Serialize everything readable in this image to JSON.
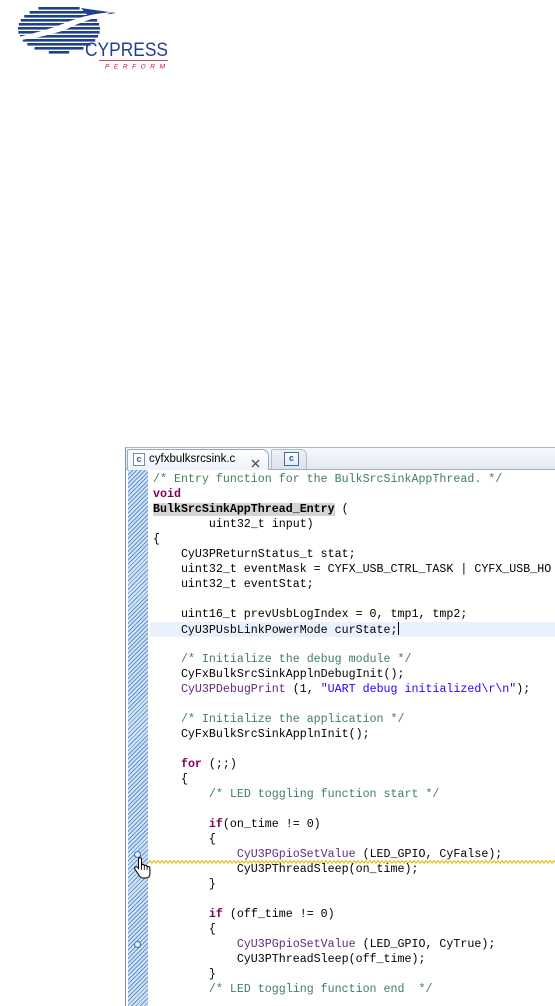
{
  "logo": {
    "icon": "cypress-globe-logo",
    "wordmark": "CYPRESS",
    "tagline": "PERFORM",
    "navy": "#1f3e95",
    "red": "#c8102e"
  },
  "editor": {
    "tabs": [
      {
        "label": "cyfxbulksrcsink.c",
        "icon": "c-source-file-icon",
        "icon_glyph": "c",
        "close_icon": "close-icon",
        "active": true
      },
      {
        "icon": "c-source-file-icon",
        "icon_glyph": "c",
        "active": false
      }
    ],
    "theme": {
      "plain": "#000000",
      "comment": "#3F7F5F",
      "keyword": "#7F0055",
      "string": "#2A00FF",
      "macro": "#642880",
      "current_line": "#E8F2FE",
      "occurrence": "#D4D4D4",
      "warning": "#E2B600",
      "ruler": "#5E93D1"
    },
    "cursor_icon": "hand-pointer-cursor-icon",
    "lines": [
      {
        "tokens": [
          {
            "k": "comment",
            "v": "/* Entry function for the BulkSrcSinkAppThread. */"
          }
        ]
      },
      {
        "tokens": [
          {
            "k": "keyword",
            "v": "void"
          }
        ]
      },
      {
        "tokens": [
          {
            "k": "decl",
            "v": "BulkSrcSinkAppThread_Entry",
            "highlight": true
          },
          {
            "k": "plain",
            "v": " ("
          }
        ]
      },
      {
        "tokens": [
          {
            "k": "plain",
            "v": "        uint32_t input)"
          }
        ]
      },
      {
        "tokens": [
          {
            "k": "plain",
            "v": "{"
          }
        ]
      },
      {
        "tokens": [
          {
            "k": "plain",
            "v": "    CyU3PReturnStatus_t stat;"
          }
        ]
      },
      {
        "tokens": [
          {
            "k": "plain",
            "v": "    uint32_t eventMask = CYFX_USB_CTRL_TASK | CYFX_USB_HO"
          }
        ]
      },
      {
        "tokens": [
          {
            "k": "plain",
            "v": "    uint32_t eventStat;"
          }
        ]
      },
      {
        "tokens": []
      },
      {
        "tokens": [
          {
            "k": "plain",
            "v": "    uint16_t prevUsbLogIndex = 0, tmp1, tmp2;"
          }
        ]
      },
      {
        "tokens": [
          {
            "k": "plain",
            "v": "    CyU3PUsbLinkPowerMode curState;"
          }
        ],
        "current": true
      },
      {
        "tokens": []
      },
      {
        "tokens": [
          {
            "k": "plain",
            "v": "    "
          },
          {
            "k": "comment",
            "v": "/* Initialize the debug module */"
          }
        ]
      },
      {
        "tokens": [
          {
            "k": "plain",
            "v": "    CyFxBulkSrcSinkApplnDebugInit();"
          }
        ]
      },
      {
        "tokens": [
          {
            "k": "plain",
            "v": "    "
          },
          {
            "k": "macro",
            "v": "CyU3PDebugPrint"
          },
          {
            "k": "plain",
            "v": " (1, "
          },
          {
            "k": "string",
            "v": "\"UART debug initialized\\r\\n\""
          },
          {
            "k": "plain",
            "v": ");"
          }
        ]
      },
      {
        "tokens": []
      },
      {
        "tokens": [
          {
            "k": "plain",
            "v": "    "
          },
          {
            "k": "comment",
            "v": "/* Initialize the application */"
          }
        ]
      },
      {
        "tokens": [
          {
            "k": "plain",
            "v": "    CyFxBulkSrcSinkApplnInit();"
          }
        ]
      },
      {
        "tokens": []
      },
      {
        "tokens": [
          {
            "k": "plain",
            "v": "    "
          },
          {
            "k": "keyword",
            "v": "for"
          },
          {
            "k": "plain",
            "v": " (;;)"
          }
        ]
      },
      {
        "tokens": [
          {
            "k": "plain",
            "v": "    {"
          }
        ]
      },
      {
        "tokens": [
          {
            "k": "plain",
            "v": "        "
          },
          {
            "k": "comment",
            "v": "/* LED toggling function start */"
          }
        ]
      },
      {
        "tokens": []
      },
      {
        "tokens": [
          {
            "k": "plain",
            "v": "        "
          },
          {
            "k": "keyword",
            "v": "if"
          },
          {
            "k": "plain",
            "v": "(on_time != 0)"
          }
        ]
      },
      {
        "tokens": [
          {
            "k": "plain",
            "v": "        {"
          }
        ]
      },
      {
        "tokens": [
          {
            "k": "plain",
            "v": "            "
          },
          {
            "k": "macro",
            "v": "CyU3PGpioSetValue"
          },
          {
            "k": "plain",
            "v": " (LED_GPIO, CyFalse);"
          }
        ],
        "warning": true,
        "marker": true
      },
      {
        "tokens": [
          {
            "k": "plain",
            "v": "            CyU3PThreadSleep(on_time);"
          }
        ]
      },
      {
        "tokens": [
          {
            "k": "plain",
            "v": "        }"
          }
        ]
      },
      {
        "tokens": []
      },
      {
        "tokens": [
          {
            "k": "plain",
            "v": "        "
          },
          {
            "k": "keyword",
            "v": "if"
          },
          {
            "k": "plain",
            "v": " (off_time != 0)"
          }
        ]
      },
      {
        "tokens": [
          {
            "k": "plain",
            "v": "        {"
          }
        ]
      },
      {
        "tokens": [
          {
            "k": "plain",
            "v": "            "
          },
          {
            "k": "macro",
            "v": "CyU3PGpioSetValue"
          },
          {
            "k": "plain",
            "v": " (LED_GPIO, CyTrue);"
          }
        ],
        "marker": true
      },
      {
        "tokens": [
          {
            "k": "plain",
            "v": "            CyU3PThreadSleep(off_time);"
          }
        ]
      },
      {
        "tokens": [
          {
            "k": "plain",
            "v": "        }"
          }
        ]
      },
      {
        "tokens": [
          {
            "k": "plain",
            "v": "        "
          },
          {
            "k": "comment",
            "v": "/* LED toggling function end  */"
          }
        ]
      }
    ]
  }
}
